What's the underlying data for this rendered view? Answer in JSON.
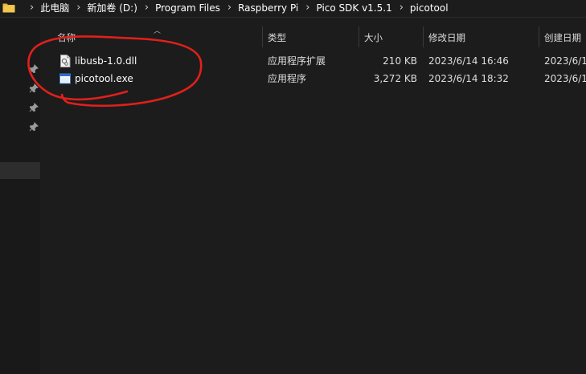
{
  "breadcrumb": {
    "items": [
      "此电脑",
      "新加卷 (D:)",
      "Program Files",
      "Raspberry Pi",
      "Pico SDK v1.5.1",
      "picotool"
    ],
    "separator": "›"
  },
  "columns": {
    "name": "名称",
    "type": "类型",
    "size": "大小",
    "modified": "修改日期",
    "created": "创建日期"
  },
  "files": [
    {
      "name": "libusb-1.0.dll",
      "type": "应用程序扩展",
      "size": "210 KB",
      "modified": "2023/6/14 16:46",
      "created": "2023/6/1",
      "icon": "dll-file-icon"
    },
    {
      "name": "picotool.exe",
      "type": "应用程序",
      "size": "3,272 KB",
      "modified": "2023/6/14 18:32",
      "created": "2023/6/1",
      "icon": "exe-file-icon"
    }
  ],
  "colors": {
    "background": "#1c1c1c",
    "annotation": "#e0201b",
    "folder": "#f4c74d"
  }
}
